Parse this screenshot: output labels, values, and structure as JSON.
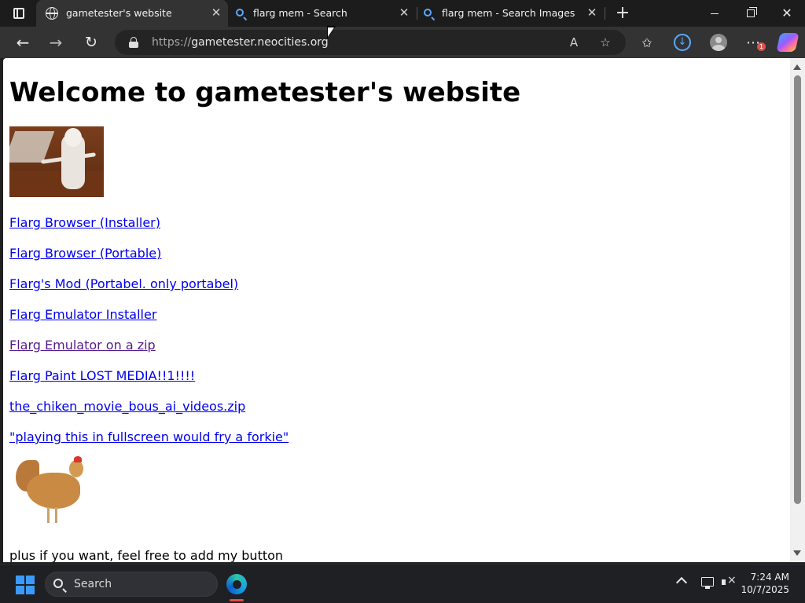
{
  "tabs": [
    {
      "title": "gametester's website",
      "active": true,
      "icon": "globe-icon"
    },
    {
      "title": "flarg mem - Search",
      "active": false,
      "icon": "search-icon"
    },
    {
      "title": "flarg mem - Search Images",
      "active": false,
      "icon": "search-icon"
    }
  ],
  "address_bar": {
    "protocol": "https://",
    "host": "gametester.neocities.org"
  },
  "page": {
    "heading": "Welcome to gametester's website",
    "links": [
      {
        "text": "Flarg Browser (Installer)",
        "visited": false
      },
      {
        "text": "Flarg Browser (Portable)",
        "visited": false
      },
      {
        "text": "Flarg's Mod (Portabel. only portabel)",
        "visited": false
      },
      {
        "text": "Flarg Emulator Installer",
        "visited": false
      },
      {
        "text": "Flarg Emulator on a zip",
        "visited": true
      },
      {
        "text": "Flarg Paint LOST MEDIA!!1!!!!",
        "visited": false
      },
      {
        "text": "the_chiken_movie_bous_ai_videos.zip",
        "visited": false
      },
      {
        "text": "\"playing this in fullscreen would fry a forkie\"",
        "visited": false
      }
    ],
    "footer_text": "plus if you want, feel free to add my button"
  },
  "taskbar": {
    "search_label": "Search",
    "time": "7:24 AM",
    "date": "10/7/2025"
  },
  "badges": {
    "more_menu_count": "1"
  },
  "colors": {
    "link": "#0000ee",
    "visited_link": "#551a8b",
    "accent": "#5aa9ff"
  }
}
